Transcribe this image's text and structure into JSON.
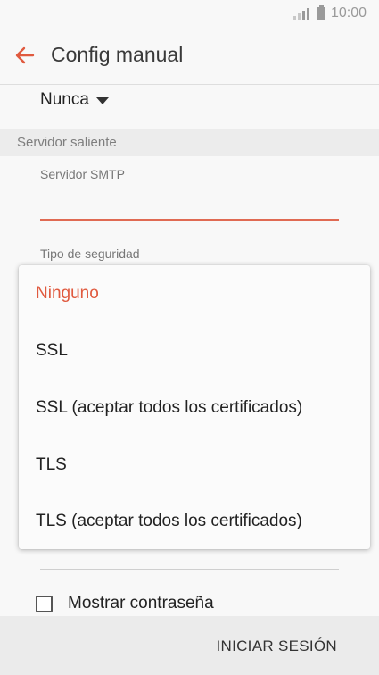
{
  "status_bar": {
    "time": "10:00"
  },
  "header": {
    "title": "Config manual"
  },
  "sync_option": {
    "value": "Nunca"
  },
  "section": {
    "title": "Servidor saliente"
  },
  "smtp": {
    "label": "Servidor SMTP",
    "value": ""
  },
  "security": {
    "label": "Tipo de seguridad",
    "options": [
      {
        "label": "Ninguno",
        "selected": true
      },
      {
        "label": "SSL",
        "selected": false
      },
      {
        "label": "SSL (aceptar todos los certificados)",
        "selected": false
      },
      {
        "label": "TLS",
        "selected": false
      },
      {
        "label": "TLS (aceptar todos los certificados)",
        "selected": false
      }
    ]
  },
  "show_password": {
    "label": "Mostrar contraseña",
    "checked": false
  },
  "footer": {
    "login_label": "INICIAR SESIÓN"
  },
  "colors": {
    "accent": "#e05a3f",
    "background": "#f8f8f8",
    "section_header_bg": "#ececec",
    "bottom_bar_bg": "#ebebeb"
  }
}
